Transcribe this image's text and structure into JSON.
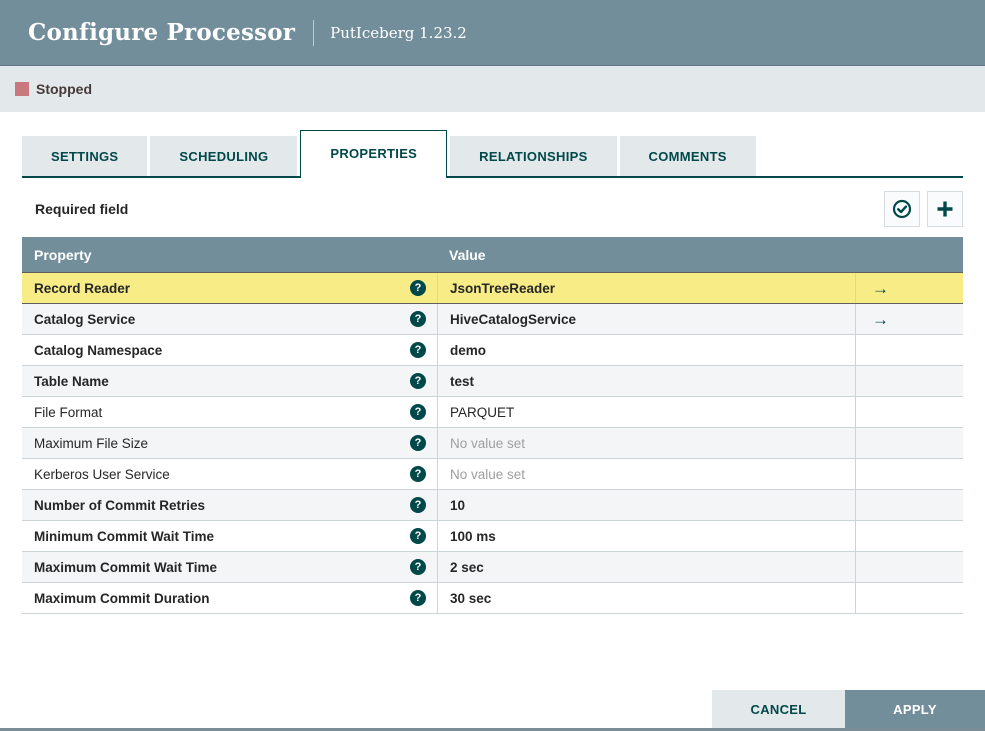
{
  "dialog": {
    "title": "Configure Processor",
    "subtitle": "PutIceberg 1.23.2"
  },
  "status": {
    "label": "Stopped",
    "color": "#C7797D"
  },
  "tabs": [
    {
      "label": "SETTINGS",
      "active": false
    },
    {
      "label": "SCHEDULING",
      "active": false
    },
    {
      "label": "PROPERTIES",
      "active": true
    },
    {
      "label": "RELATIONSHIPS",
      "active": false
    },
    {
      "label": "COMMENTS",
      "active": false
    }
  ],
  "properties_panel": {
    "required_field_label": "Required field",
    "toolbar_icons": [
      {
        "name": "verify-properties-icon",
        "glyph": "circle-check"
      },
      {
        "name": "add-property-icon",
        "glyph": "plus"
      }
    ],
    "table": {
      "columns": {
        "property": "Property",
        "value": "Value"
      },
      "rows": [
        {
          "property": "Record Reader",
          "value": "JsonTreeReader",
          "required": true,
          "selected": true,
          "unset": false,
          "goto": true
        },
        {
          "property": "Catalog Service",
          "value": "HiveCatalogService",
          "required": true,
          "selected": false,
          "unset": false,
          "goto": true
        },
        {
          "property": "Catalog Namespace",
          "value": "demo",
          "required": true,
          "selected": false,
          "unset": false,
          "goto": false
        },
        {
          "property": "Table Name",
          "value": "test",
          "required": true,
          "selected": false,
          "unset": false,
          "goto": false
        },
        {
          "property": "File Format",
          "value": "PARQUET",
          "required": false,
          "selected": false,
          "unset": false,
          "goto": false
        },
        {
          "property": "Maximum File Size",
          "value": "No value set",
          "required": false,
          "selected": false,
          "unset": true,
          "goto": false
        },
        {
          "property": "Kerberos User Service",
          "value": "No value set",
          "required": false,
          "selected": false,
          "unset": true,
          "goto": false
        },
        {
          "property": "Number of Commit Retries",
          "value": "10",
          "required": true,
          "selected": false,
          "unset": false,
          "goto": false
        },
        {
          "property": "Minimum Commit Wait Time",
          "value": "100 ms",
          "required": true,
          "selected": false,
          "unset": false,
          "goto": false
        },
        {
          "property": "Maximum Commit Wait Time",
          "value": "2 sec",
          "required": true,
          "selected": false,
          "unset": false,
          "goto": false
        },
        {
          "property": "Maximum Commit Duration",
          "value": "30 sec",
          "required": true,
          "selected": false,
          "unset": false,
          "goto": false
        }
      ]
    }
  },
  "footer": {
    "cancel_label": "CANCEL",
    "apply_label": "APPLY"
  },
  "colors": {
    "header_bg": "#728E9B",
    "accent_teal": "#004849",
    "status_bar_bg": "#E3E8EB",
    "selected_row_bg": "#F7EC86",
    "striped_row_bg": "#F3F5F7"
  }
}
